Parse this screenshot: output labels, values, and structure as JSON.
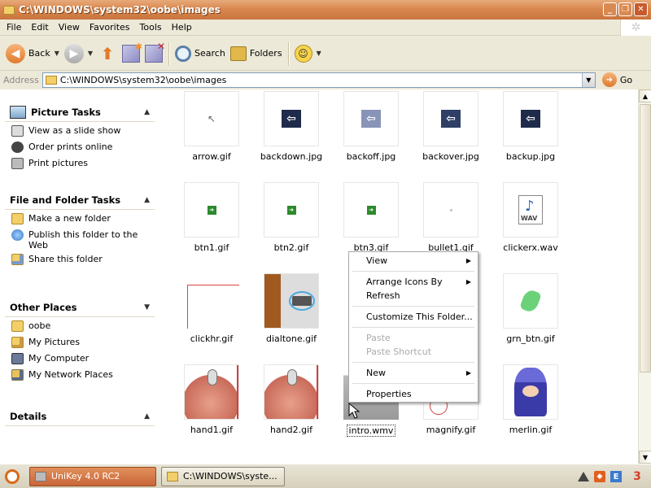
{
  "window": {
    "title": "C:\\WINDOWS\\system32\\oobe\\images",
    "controls": [
      "_",
      "❐",
      "✕"
    ]
  },
  "menubar": {
    "items": [
      "File",
      "Edit",
      "View",
      "Favorites",
      "Tools",
      "Help"
    ]
  },
  "toolbar": {
    "back_label": "Back",
    "search_label": "Search",
    "folders_label": "Folders"
  },
  "address": {
    "label": "Address",
    "value": "C:\\WINDOWS\\system32\\oobe\\images",
    "go_label": "Go"
  },
  "taskpane": {
    "picture_tasks": {
      "title": "Picture Tasks",
      "items": [
        "View as a slide show",
        "Order prints online",
        "Print pictures"
      ]
    },
    "file_folder_tasks": {
      "title": "File and Folder Tasks",
      "items": [
        "Make a new folder",
        "Publish this folder to the Web",
        "Share this folder"
      ]
    },
    "other_places": {
      "title": "Other Places",
      "items": [
        "oobe",
        "My Pictures",
        "My Computer",
        "My Network Places"
      ]
    },
    "details": {
      "title": "Details"
    }
  },
  "files": [
    "arrow.gif",
    "backdown.jpg",
    "backoff.jpg",
    "backover.jpg",
    "backup.jpg",
    "btn1.gif",
    "btn2.gif",
    "btn3.gif",
    "bullet1.gif",
    "clickerx.wav",
    "clickhr.gif",
    "dialtone.gif",
    "",
    "",
    "grn_btn.gif",
    "hand1.gif",
    "hand2.gif",
    "intro.wmv",
    "magnify.gif",
    "merlin.gif"
  ],
  "wav_label": "WAV",
  "context_menu": {
    "view": "View",
    "arrange": "Arrange Icons By",
    "refresh": "Refresh",
    "customize": "Customize This Folder...",
    "paste": "Paste",
    "paste_shortcut": "Paste Shortcut",
    "new": "New",
    "properties": "Properties"
  },
  "taskbar": {
    "task1": "UniKey 4.0 RC2",
    "task2": "C:\\WINDOWS\\syste...",
    "tray_text": "3"
  }
}
